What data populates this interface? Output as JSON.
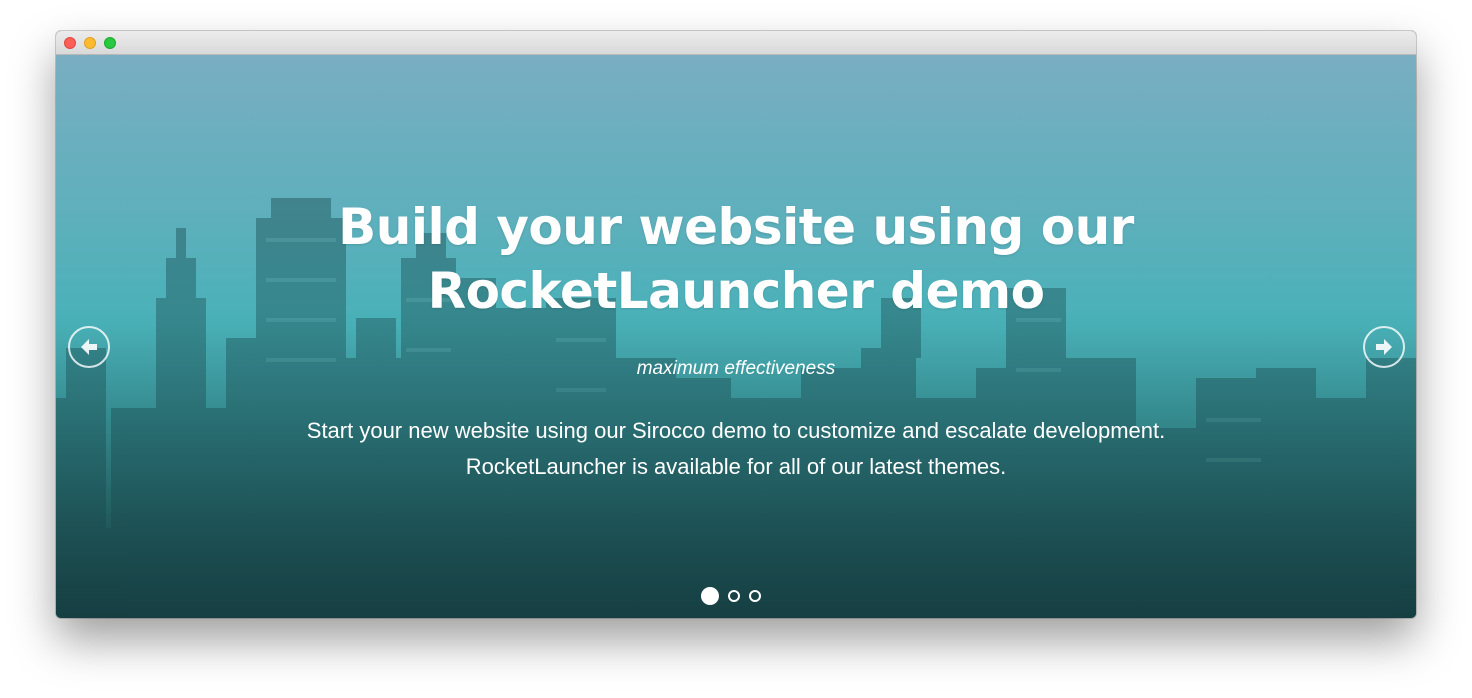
{
  "window": {
    "controls": [
      "close",
      "minimize",
      "maximize"
    ]
  },
  "hero": {
    "headline_line1": "Build your website using our",
    "headline_line2": "RocketLauncher demo",
    "tagline": "maximum effectiveness",
    "description_line1": "Start your new website using our Sirocco demo to customize and escalate development.",
    "description_line2": "RocketLauncher is available for all of our latest themes.",
    "background_image": "city-skyline-teal-overlay"
  },
  "carousel": {
    "prev_icon": "arrow-left-circle-icon",
    "next_icon": "arrow-right-circle-icon",
    "slide_count": 3,
    "active_slide": 1
  },
  "colors": {
    "overlay_top": "#7aaec2",
    "overlay_mid": "#4cb3ba",
    "overlay_bottom": "#1b4447",
    "text": "#ffffff",
    "close": "#fc5f57",
    "minimize": "#fdbc2e",
    "maximize": "#28c840"
  }
}
